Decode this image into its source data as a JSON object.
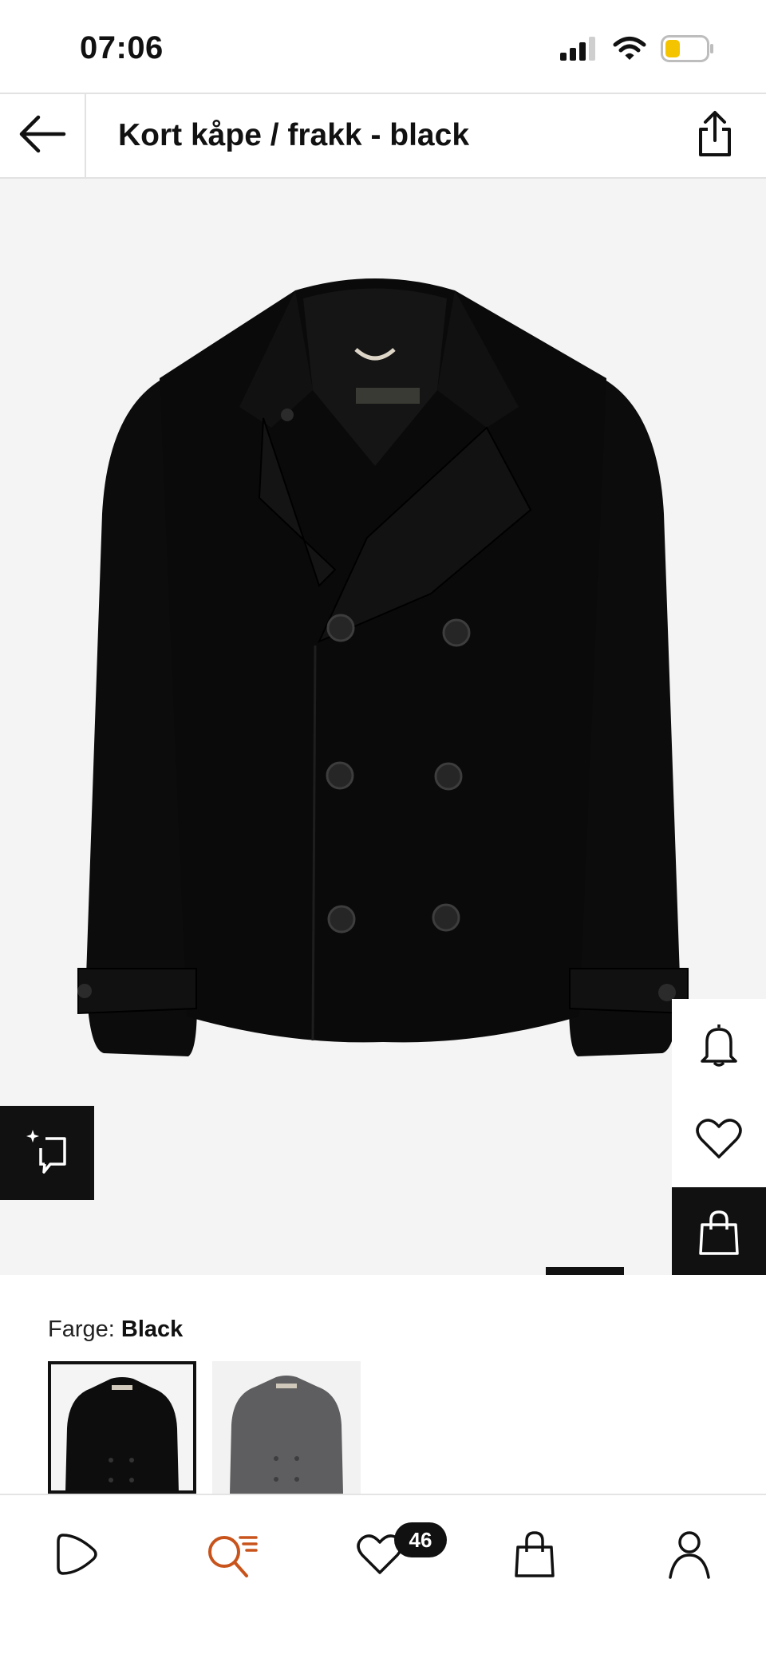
{
  "status_bar": {
    "time": "07:06",
    "icons": [
      "signal-icon",
      "wifi-icon",
      "battery-icon"
    ]
  },
  "header": {
    "title": "Kort kåpe / frakk - black",
    "back_icon": "arrow-left-icon",
    "share_icon": "share-icon"
  },
  "product": {
    "image": "black-double-breasted-pea-coat",
    "actions": [
      "bell-icon",
      "heart-icon",
      "shopping-bag-icon"
    ],
    "ai_icon": "sparkle-chat-icon"
  },
  "color": {
    "label": "Farge:",
    "selected": "Black",
    "swatches": [
      {
        "name": "Black",
        "color": "#0d0d0d",
        "selected": true
      },
      {
        "name": "Grey",
        "color": "#5e5e60",
        "selected": false
      }
    ]
  },
  "nav": {
    "items": [
      "play-icon",
      "search-icon",
      "heart-icon",
      "shopping-bag-icon",
      "profile-icon"
    ],
    "active_color": "#c8541c",
    "wishlist_count": "46"
  }
}
